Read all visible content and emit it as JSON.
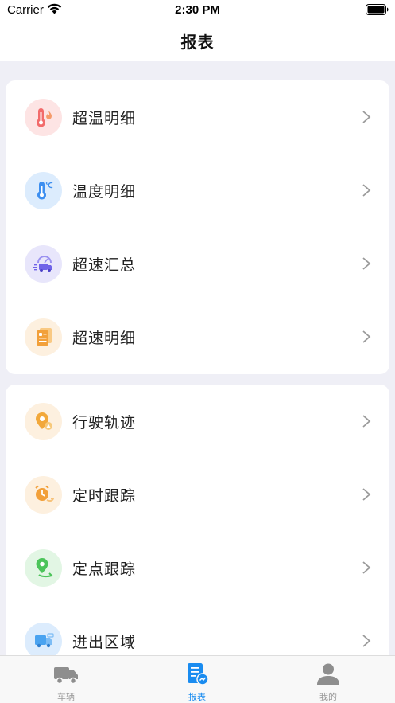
{
  "status": {
    "carrier": "Carrier",
    "time": "2:30 PM"
  },
  "nav": {
    "title": "报表"
  },
  "sections": [
    {
      "items": [
        {
          "label": "超温明细",
          "icon": "thermometer-fire-icon",
          "bg": "#fde4e4",
          "color": "#f26b6b"
        },
        {
          "label": "温度明细",
          "icon": "thermometer-celsius-icon",
          "bg": "#dcecfd",
          "color": "#3d8ff0"
        },
        {
          "label": "超速汇总",
          "icon": "speed-truck-icon",
          "bg": "#e8e6fb",
          "color": "#6f63e8"
        },
        {
          "label": "超速明细",
          "icon": "speed-document-icon",
          "bg": "#fdf0df",
          "color": "#f2a03a"
        }
      ]
    },
    {
      "items": [
        {
          "label": "行驶轨迹",
          "icon": "location-pin-icon",
          "bg": "#fdf0df",
          "color": "#f2a83a"
        },
        {
          "label": "定时跟踪",
          "icon": "alarm-clock-icon",
          "bg": "#fdf0df",
          "color": "#f2a03a"
        },
        {
          "label": "定点跟踪",
          "icon": "map-pin-green-icon",
          "bg": "#e2f6e4",
          "color": "#4cc45a"
        },
        {
          "label": "进出区域",
          "icon": "truck-area-icon",
          "bg": "#dcecfd",
          "color": "#4aa3f0"
        }
      ]
    }
  ],
  "tabs": [
    {
      "label": "车辆",
      "icon": "truck-icon",
      "active": false
    },
    {
      "label": "报表",
      "icon": "report-icon",
      "active": true
    },
    {
      "label": "我的",
      "icon": "person-icon",
      "active": false
    }
  ],
  "colors": {
    "accent": "#1a8cf0",
    "background": "#efeff6",
    "tab_inactive": "#999999"
  }
}
